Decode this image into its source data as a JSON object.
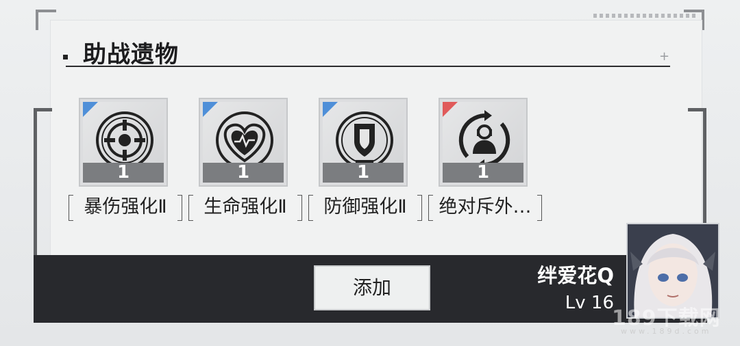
{
  "title": "助战遗物",
  "relics": [
    {
      "name": "暴伤强化Ⅱ",
      "count": "1",
      "icon": "crit-damage-icon",
      "rarity_color": "#4f8fd8"
    },
    {
      "name": "生命强化Ⅱ",
      "count": "1",
      "icon": "heart-health-icon",
      "rarity_color": "#4f8fd8"
    },
    {
      "name": "防御强化Ⅱ",
      "count": "1",
      "icon": "shield-icon",
      "rarity_color": "#4f8fd8"
    },
    {
      "name": "绝对斥外…",
      "count": "1",
      "icon": "person-cycle-icon",
      "rarity_color": "#e05a5a"
    }
  ],
  "add_button_label": "添加",
  "support_user": {
    "name": "绊爱花Q",
    "level": "Lv 16"
  },
  "watermark": {
    "text": "189下载网",
    "sub": "www.189d.com"
  }
}
